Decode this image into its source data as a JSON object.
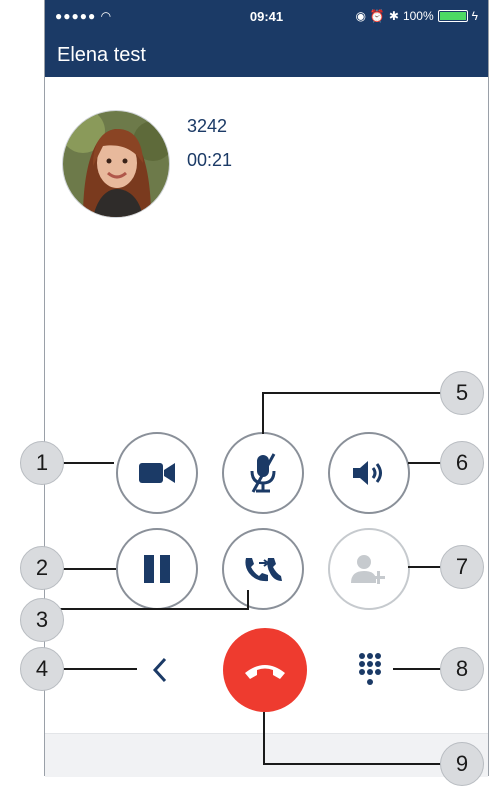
{
  "status_bar": {
    "signal": "●●●●● ",
    "time": "09:41",
    "battery_percent": "100%",
    "icons": [
      "wifi-icon",
      "orientation-lock-icon",
      "alarm-icon",
      "bluetooth-icon",
      "battery-icon",
      "charging-icon"
    ]
  },
  "nav": {
    "title": "Elena test"
  },
  "call": {
    "number": "3242",
    "duration": "00:21"
  },
  "controls": {
    "row1": [
      "video-camera-icon",
      "mute-microphone-icon",
      "speaker-icon"
    ],
    "row2": [
      "pause-icon",
      "transfer-call-icon",
      "add-participant-icon"
    ],
    "row3": [
      "back-chevron-icon",
      "hang-up-icon",
      "dialpad-icon"
    ]
  },
  "callouts": [
    "1",
    "2",
    "3",
    "4",
    "5",
    "6",
    "7",
    "8",
    "9"
  ],
  "colors": {
    "navbar": "#1b3a66",
    "icon": "#1b3a66",
    "hangup": "#ee3b2f",
    "disabled": "#c6cace"
  }
}
